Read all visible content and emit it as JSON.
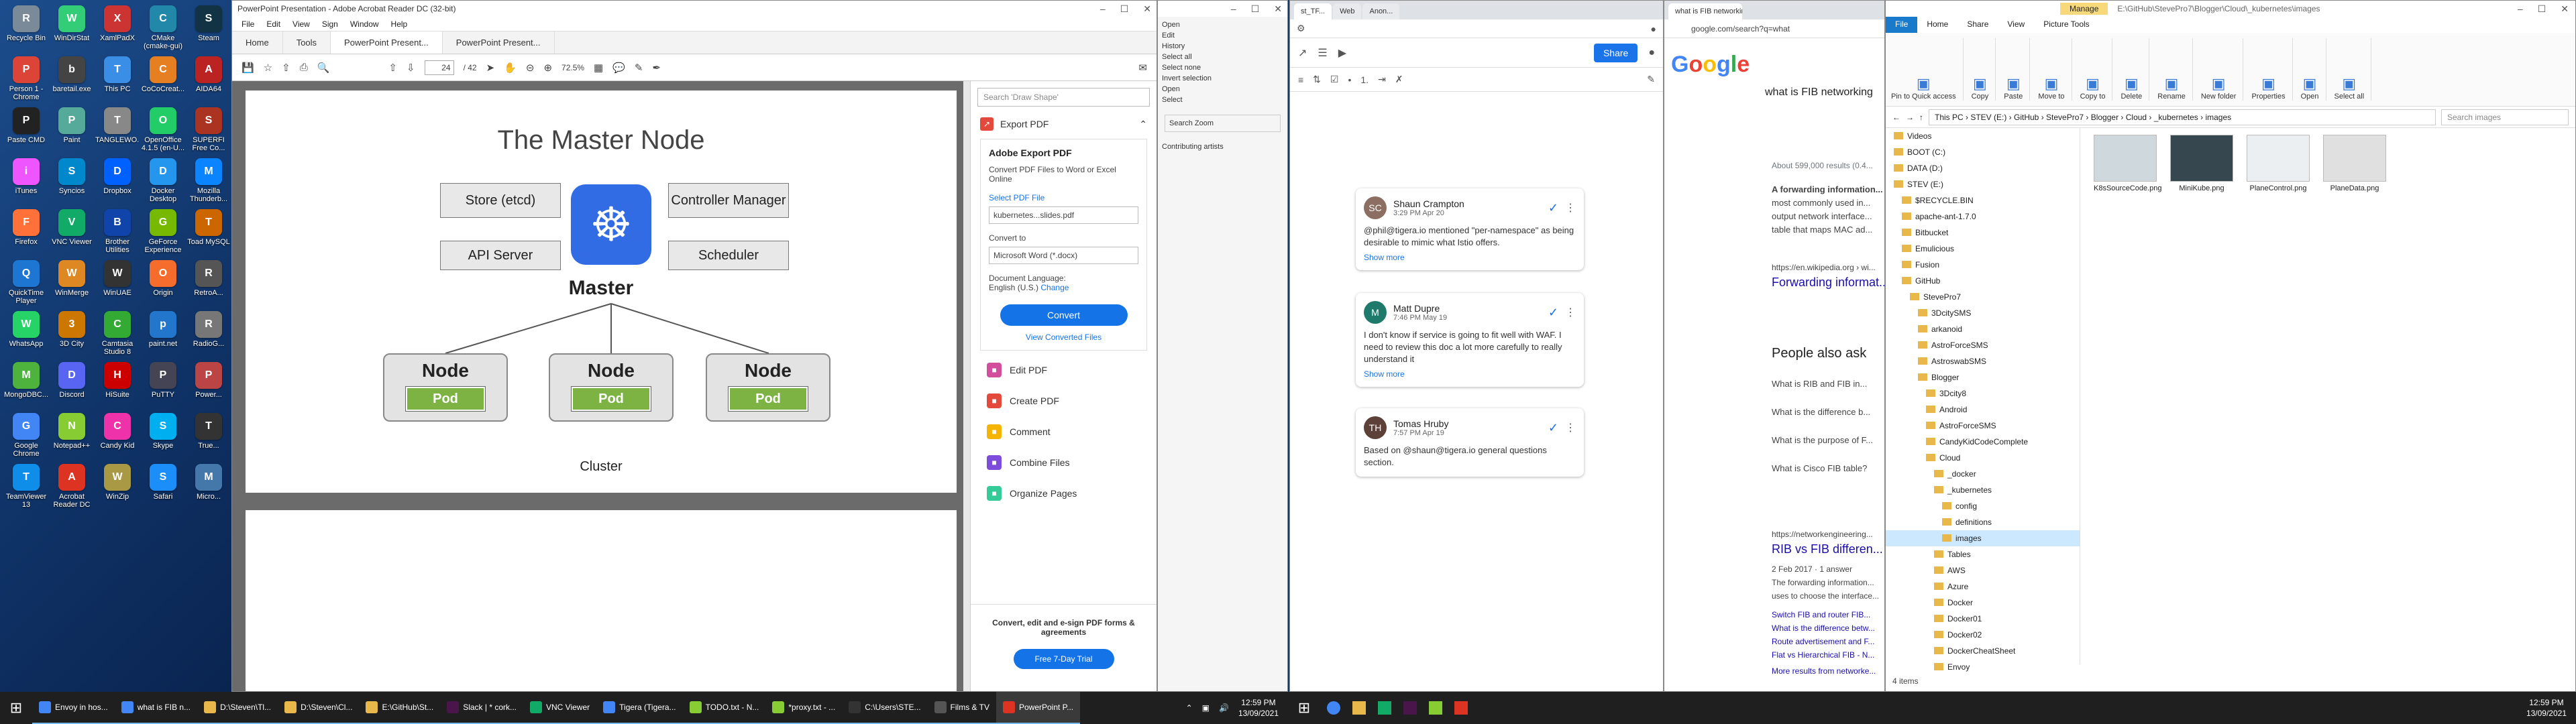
{
  "desktop_icons": [
    {
      "label": "Recycle Bin",
      "color": "#7a8a99"
    },
    {
      "label": "WinDirStat",
      "color": "#3c7"
    },
    {
      "label": "XamlPadX",
      "color": "#c33"
    },
    {
      "label": "CMake (cmake-gui)",
      "color": "#28a"
    },
    {
      "label": "Steam",
      "color": "#134"
    },
    {
      "label": "Person 1 - Chrome",
      "color": "#db4437"
    },
    {
      "label": "baretail.exe",
      "color": "#444"
    },
    {
      "label": "This PC",
      "color": "#3a8ee6"
    },
    {
      "label": "CoCoCreat...",
      "color": "#e67e22"
    },
    {
      "label": "AIDA64",
      "color": "#b22"
    },
    {
      "label": "Paste CMD",
      "color": "#222"
    },
    {
      "label": "Paint",
      "color": "#5a9"
    },
    {
      "label": "TANGLEWO...",
      "color": "#888"
    },
    {
      "label": "OpenOffice 4.1.5 (en-U...",
      "color": "#2c6"
    },
    {
      "label": "SUPERFI Free Co...",
      "color": "#a32"
    },
    {
      "label": "iTunes",
      "color": "#e5f"
    },
    {
      "label": "Syncios",
      "color": "#08c"
    },
    {
      "label": "Dropbox",
      "color": "#0061fe"
    },
    {
      "label": "Docker Desktop",
      "color": "#2496ed"
    },
    {
      "label": "Mozilla Thunderb...",
      "color": "#0a84ff"
    },
    {
      "label": "Firefox",
      "color": "#ff7139"
    },
    {
      "label": "VNC Viewer",
      "color": "#1a6"
    },
    {
      "label": "Brother Utilities",
      "color": "#14a"
    },
    {
      "label": "GeForce Experience",
      "color": "#76b900"
    },
    {
      "label": "Toad MySQL",
      "color": "#c60"
    },
    {
      "label": "QuickTime Player",
      "color": "#1d76d2"
    },
    {
      "label": "WinMerge",
      "color": "#d82"
    },
    {
      "label": "WinUAE",
      "color": "#333"
    },
    {
      "label": "Origin",
      "color": "#f56c2d"
    },
    {
      "label": "RetroA...",
      "color": "#555"
    },
    {
      "label": "WhatsApp",
      "color": "#25d366"
    },
    {
      "label": "3D City",
      "color": "#c70"
    },
    {
      "label": "Camtasia Studio 8",
      "color": "#3a3"
    },
    {
      "label": "paint.net",
      "color": "#27c"
    },
    {
      "label": "RadioG...",
      "color": "#777"
    },
    {
      "label": "MongoDBC...",
      "color": "#4db33d"
    },
    {
      "label": "Discord",
      "color": "#5865f2"
    },
    {
      "label": "HiSuite",
      "color": "#c00"
    },
    {
      "label": "PuTTY",
      "color": "#445"
    },
    {
      "label": "Power...",
      "color": "#b44"
    },
    {
      "label": "Google Chrome",
      "color": "#4285f4"
    },
    {
      "label": "Notepad++",
      "color": "#8c3"
    },
    {
      "label": "Candy Kid",
      "color": "#e3a"
    },
    {
      "label": "Skype",
      "color": "#00aff0"
    },
    {
      "label": "True...",
      "color": "#333"
    },
    {
      "label": "TeamViewer 13",
      "color": "#0e8ee9"
    },
    {
      "label": "Acrobat Reader DC",
      "color": "#d32"
    },
    {
      "label": "WinZip",
      "color": "#a94"
    },
    {
      "label": "Safari",
      "color": "#1c8ef9"
    },
    {
      "label": "Micro...",
      "color": "#47a"
    }
  ],
  "acrobat": {
    "title": "PowerPoint Presentation - Adobe Acrobat Reader DC (32-bit)",
    "menu": [
      "File",
      "Edit",
      "View",
      "Sign",
      "Window",
      "Help"
    ],
    "tabs": [
      "Home",
      "Tools",
      "PowerPoint Present...",
      "PowerPoint Present..."
    ],
    "page_current": "24",
    "page_total": "/ 42",
    "zoom": "72.5%",
    "slide": {
      "title": "The Master Node",
      "store": "Store (etcd)",
      "controller": "Controller Manager",
      "api": "API Server",
      "scheduler": "Scheduler",
      "master": "Master",
      "node_label": "Node",
      "pod_label": "Pod",
      "cluster": "Cluster"
    },
    "tools_pane": {
      "search_placeholder": "Search 'Draw Shape'",
      "export_header": "Export PDF",
      "card_title": "Adobe Export PDF",
      "card_desc": "Convert PDF Files to Word or Excel Online",
      "select_pdf": "Select PDF File",
      "file_name": "kubernetes...slides.pdf",
      "convert_to": "Convert to",
      "convert_value": "Microsoft Word (*.docx)",
      "doc_lang": "Document Language:",
      "lang_value": "English (U.S.)",
      "change": "Change",
      "convert_btn": "Convert",
      "view_converted": "View Converted Files",
      "tools": [
        {
          "label": "Edit PDF",
          "color": "#d24f9e"
        },
        {
          "label": "Create PDF",
          "color": "#e34a3b"
        },
        {
          "label": "Comment",
          "color": "#f4b400"
        },
        {
          "label": "Combine Files",
          "color": "#7d4cdb"
        },
        {
          "label": "Organize Pages",
          "color": "#3c9"
        }
      ],
      "promo": "Convert, edit and e-sign PDF forms & agreements",
      "trial": "Free 7-Day Trial"
    }
  },
  "editor": {
    "ribbon": [
      "Open",
      "Edit",
      "History",
      "Select all",
      "Select none",
      "Invert selection",
      "Open",
      "Select"
    ],
    "search": "Search Zoom",
    "item": "Contributing artists"
  },
  "docs": {
    "tabs": [
      "st_TF...",
      "Web",
      "Anon..."
    ],
    "share": "Share",
    "comments": [
      {
        "name": "Shaun Crampton",
        "time": "3:29 PM Apr 20",
        "text": "@phil@tigera.io mentioned \"per-namespace\" as being desirable to mimic what Istio offers.",
        "more": "Show more",
        "avatar": "SC",
        "color": "#8d6e63"
      },
      {
        "name": "Matt Dupre",
        "time": "7:46 PM May 19",
        "text": "I don't know if service is going to fit well with WAF. I need to review this doc a lot more carefully to really understand it",
        "more": "Show more",
        "avatar": "M",
        "color": "#1e7b6b"
      },
      {
        "name": "Tomas Hruby",
        "time": "7:57 PM Apr 19",
        "text": "Based on @shaun@tigera.io general questions section.",
        "more": "",
        "avatar": "TH",
        "color": "#5d4037"
      }
    ]
  },
  "search": {
    "tab_title": "what is FIB networking - Google",
    "url": "google.com/search?q=what",
    "query": "what is FIB networking",
    "results_count": "About 599,000 results (0.4...",
    "snippet1": "A forwarding information...",
    "snippet2": "most commonly used in...",
    "snippet3": "output network interface...",
    "snippet4": "table that maps MAC ad...",
    "url1": "https://en.wikipedia.org › wi...",
    "link1": "Forwarding informat...",
    "paa": "People also ask",
    "q1": "What is RIB and FIB in...",
    "q2": "What is the difference b...",
    "q3": "What is the purpose of F...",
    "q4": "What is Cisco FIB table?",
    "url2": "https://networkengineering...",
    "link2": "RIB vs FIB differen...",
    "date": "2 Feb 2017 · 1 answer",
    "snippet5": "The forwarding information...",
    "snippet6": "uses to choose the interface...",
    "sub1": "Switch FIB and router FIB...",
    "sub2": "What is the difference betw...",
    "sub3": "Route advertisement and F...",
    "sub4": "Flat vs Hierarchical FIB - N...",
    "more": "More results from networke..."
  },
  "explorer": {
    "manage": "Manage",
    "path_title": "E:\\GitHub\\StevePro7\\Blogger\\Cloud\\_kubernetes\\images",
    "tabs": [
      "File",
      "Home",
      "Share",
      "View",
      "Picture Tools"
    ],
    "ribbon": [
      "Pin to Quick access",
      "Copy",
      "Paste",
      "Move to",
      "Copy to",
      "Delete",
      "Rename",
      "New folder",
      "Properties",
      "Open",
      "Select all"
    ],
    "address": "This PC  ›  STEV (E:)  ›  GitHub  ›  StevePro7  ›  Blogger  ›  Cloud  ›  _kubernetes  ›  images",
    "search_placeholder": "Search images",
    "tree": [
      "Videos",
      "BOOT (C:)",
      "DATA (D:)",
      "STEV (E:)",
      "$RECYCLE.BIN",
      "apache-ant-1.7.0",
      "Bitbucket",
      "Emulicious",
      "Fusion",
      "GitHub",
      "StevePro7",
      "3DcitySMS",
      "arkanoid",
      "AstroForceSMS",
      "AstroswabSMS",
      "Blogger",
      "3Dcity8",
      "Android",
      "AstroForceSMS",
      "CandyKidCodeComplete",
      "Cloud",
      "_docker",
      "_kubernetes",
      "config",
      "definitions",
      "images",
      "Tables",
      "AWS",
      "Azure",
      "Docker",
      "Docker01",
      "Docker02",
      "DockerCheatSheet",
      "Envoy"
    ],
    "selected": "images",
    "files": [
      {
        "name": "K8sSourceCode.png",
        "color": "#cfd8dc"
      },
      {
        "name": "MiniKube.png",
        "color": "#37474f"
      },
      {
        "name": "PlaneControl.png",
        "color": "#eceff1"
      },
      {
        "name": "PlaneData.png",
        "color": "#e0e0e0"
      }
    ],
    "status": "4 items"
  },
  "taskbar1": [
    {
      "label": "Envoy in hos...",
      "color": "#4285f4"
    },
    {
      "label": "what is FIB n...",
      "color": "#4285f4"
    },
    {
      "label": "D:\\Steven\\Tl...",
      "color": "#e8b84b"
    },
    {
      "label": "D:\\Steven\\Cl...",
      "color": "#e8b84b"
    },
    {
      "label": "E:\\GitHub\\St...",
      "color": "#e8b84b"
    },
    {
      "label": "Slack | * cork...",
      "color": "#4a154b"
    },
    {
      "label": "VNC Viewer",
      "color": "#1a6"
    },
    {
      "label": "Tigera (Tigera...",
      "color": "#4285f4"
    },
    {
      "label": "TODO.txt - N...",
      "color": "#8c3"
    },
    {
      "label": "*proxy.txt - ...",
      "color": "#8c3"
    },
    {
      "label": "C:\\Users\\STE...",
      "color": "#333"
    },
    {
      "label": "Films & TV",
      "color": "#555"
    },
    {
      "label": "PowerPoint P...",
      "color": "#d32"
    }
  ],
  "clock": {
    "time": "12:59 PM",
    "date": "13/09/2021"
  }
}
